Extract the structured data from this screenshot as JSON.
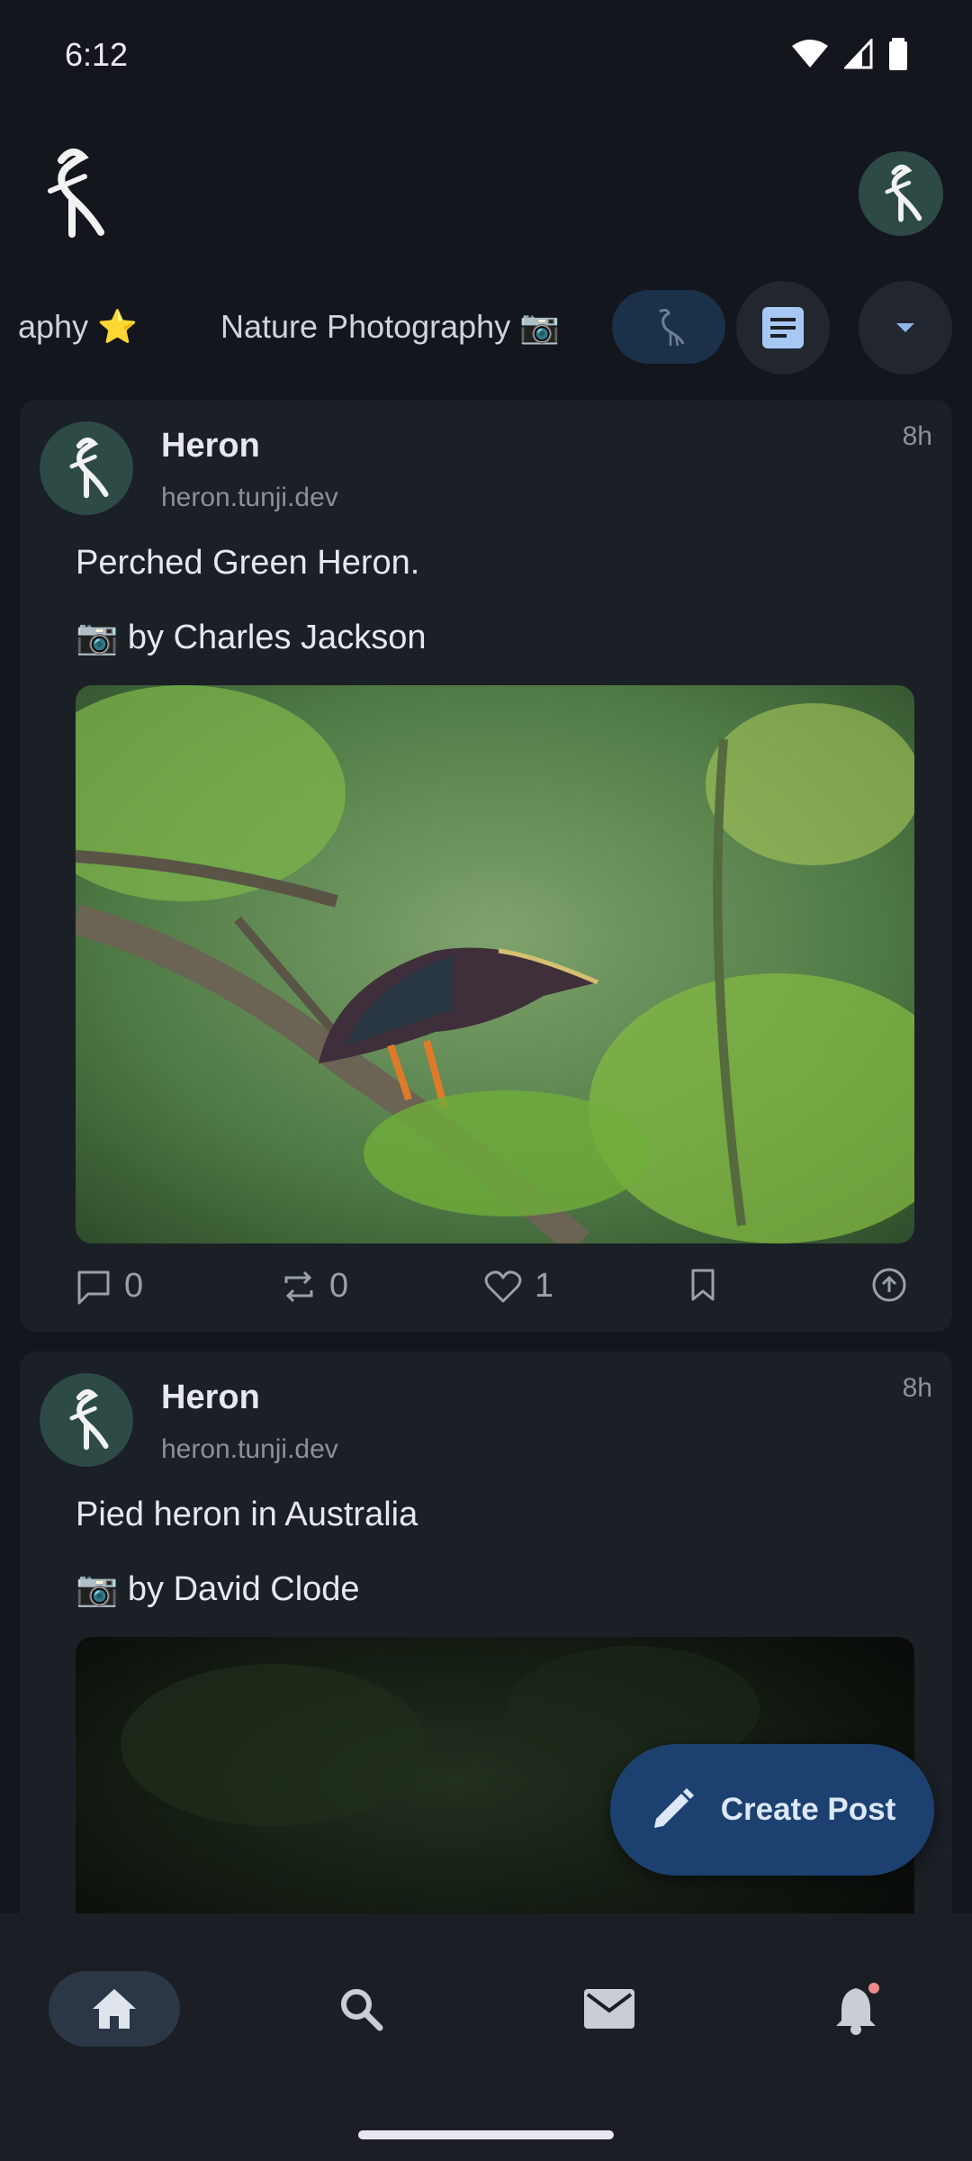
{
  "status_bar": {
    "time": "6:12"
  },
  "tabs": [
    {
      "label": "aphy ⭐"
    },
    {
      "label": "Nature Photography 📷"
    }
  ],
  "posts": [
    {
      "name": "Heron",
      "handle": "heron.tunji.dev",
      "time": "8h",
      "text": "Perched Green Heron.",
      "credit": "📷 by Charles Jackson",
      "comments": "0",
      "reposts": "0",
      "likes": "1"
    },
    {
      "name": "Heron",
      "handle": "heron.tunji.dev",
      "time": "8h",
      "text": "Pied heron in Australia",
      "credit": "📷 by David Clode"
    }
  ],
  "fab": {
    "label": "Create Post"
  },
  "colors": {
    "background": "#13161c",
    "card": "#1b1f26",
    "accent": "#1c4170",
    "avatar": "#2d4a46",
    "notification_dot": "#f08a8a"
  },
  "icons": {
    "logo": "heron-logo-icon",
    "home": "home-icon",
    "search": "search-icon",
    "mail": "mail-icon",
    "notifications": "bell-icon"
  }
}
